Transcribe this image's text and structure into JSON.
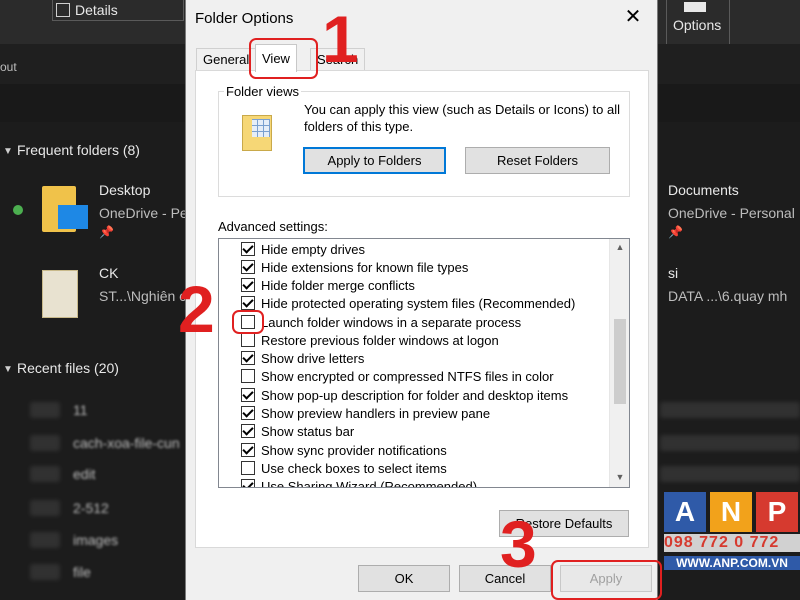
{
  "explorer": {
    "details_label": "Details",
    "options_label": "Options",
    "layout_label": "out",
    "frequent_header": "Frequent folders (8)",
    "recent_header": "Recent files (20)",
    "folders": [
      {
        "name": "Desktop",
        "location": "OneDrive - Pe"
      },
      {
        "name": "CK",
        "location": "ST...\\Nghiên c"
      },
      {
        "name": "Documents",
        "location": "OneDrive - Personal"
      },
      {
        "name": "si",
        "location": "DATA ...\\6.quay mh"
      }
    ],
    "recent_files": [
      "11",
      "cach-xoa-file-cun",
      "edit",
      "2-512",
      "images",
      "file"
    ]
  },
  "dialog": {
    "title": "Folder Options",
    "tabs": [
      "General",
      "View",
      "Search"
    ],
    "folder_views": {
      "legend": "Folder views",
      "description": "You can apply this view (such as Details or Icons) to all folders of this type.",
      "apply_label": "Apply to Folders",
      "reset_label": "Reset Folders"
    },
    "advanced_label": "Advanced settings:",
    "settings": [
      {
        "label": "Hide empty drives",
        "checked": true
      },
      {
        "label": "Hide extensions for known file types",
        "checked": true
      },
      {
        "label": "Hide folder merge conflicts",
        "checked": true
      },
      {
        "label": "Hide protected operating system files (Recommended)",
        "checked": true
      },
      {
        "label": "Launch folder windows in a separate process",
        "checked": false
      },
      {
        "label": "Restore previous folder windows at logon",
        "checked": false
      },
      {
        "label": "Show drive letters",
        "checked": true
      },
      {
        "label": "Show encrypted or compressed NTFS files in color",
        "checked": false
      },
      {
        "label": "Show pop-up description for folder and desktop items",
        "checked": true
      },
      {
        "label": "Show preview handlers in preview pane",
        "checked": true
      },
      {
        "label": "Show status bar",
        "checked": true
      },
      {
        "label": "Show sync provider notifications",
        "checked": true
      },
      {
        "label": "Use check boxes to select items",
        "checked": false
      },
      {
        "label": "Use Sharing Wizard (Recommended)",
        "checked": true
      }
    ],
    "restore_defaults_label": "Restore Defaults",
    "ok_label": "OK",
    "cancel_label": "Cancel",
    "apply_label": "Apply"
  },
  "annotations": [
    "1",
    "2",
    "3"
  ],
  "logo": {
    "letters": [
      "A",
      "N",
      "P"
    ],
    "phone": "098 772 0 772",
    "website": "WWW.ANP.COM.VN"
  },
  "colors": {
    "accent_blue": "#0078d7",
    "annotation_red": "#e02020"
  }
}
